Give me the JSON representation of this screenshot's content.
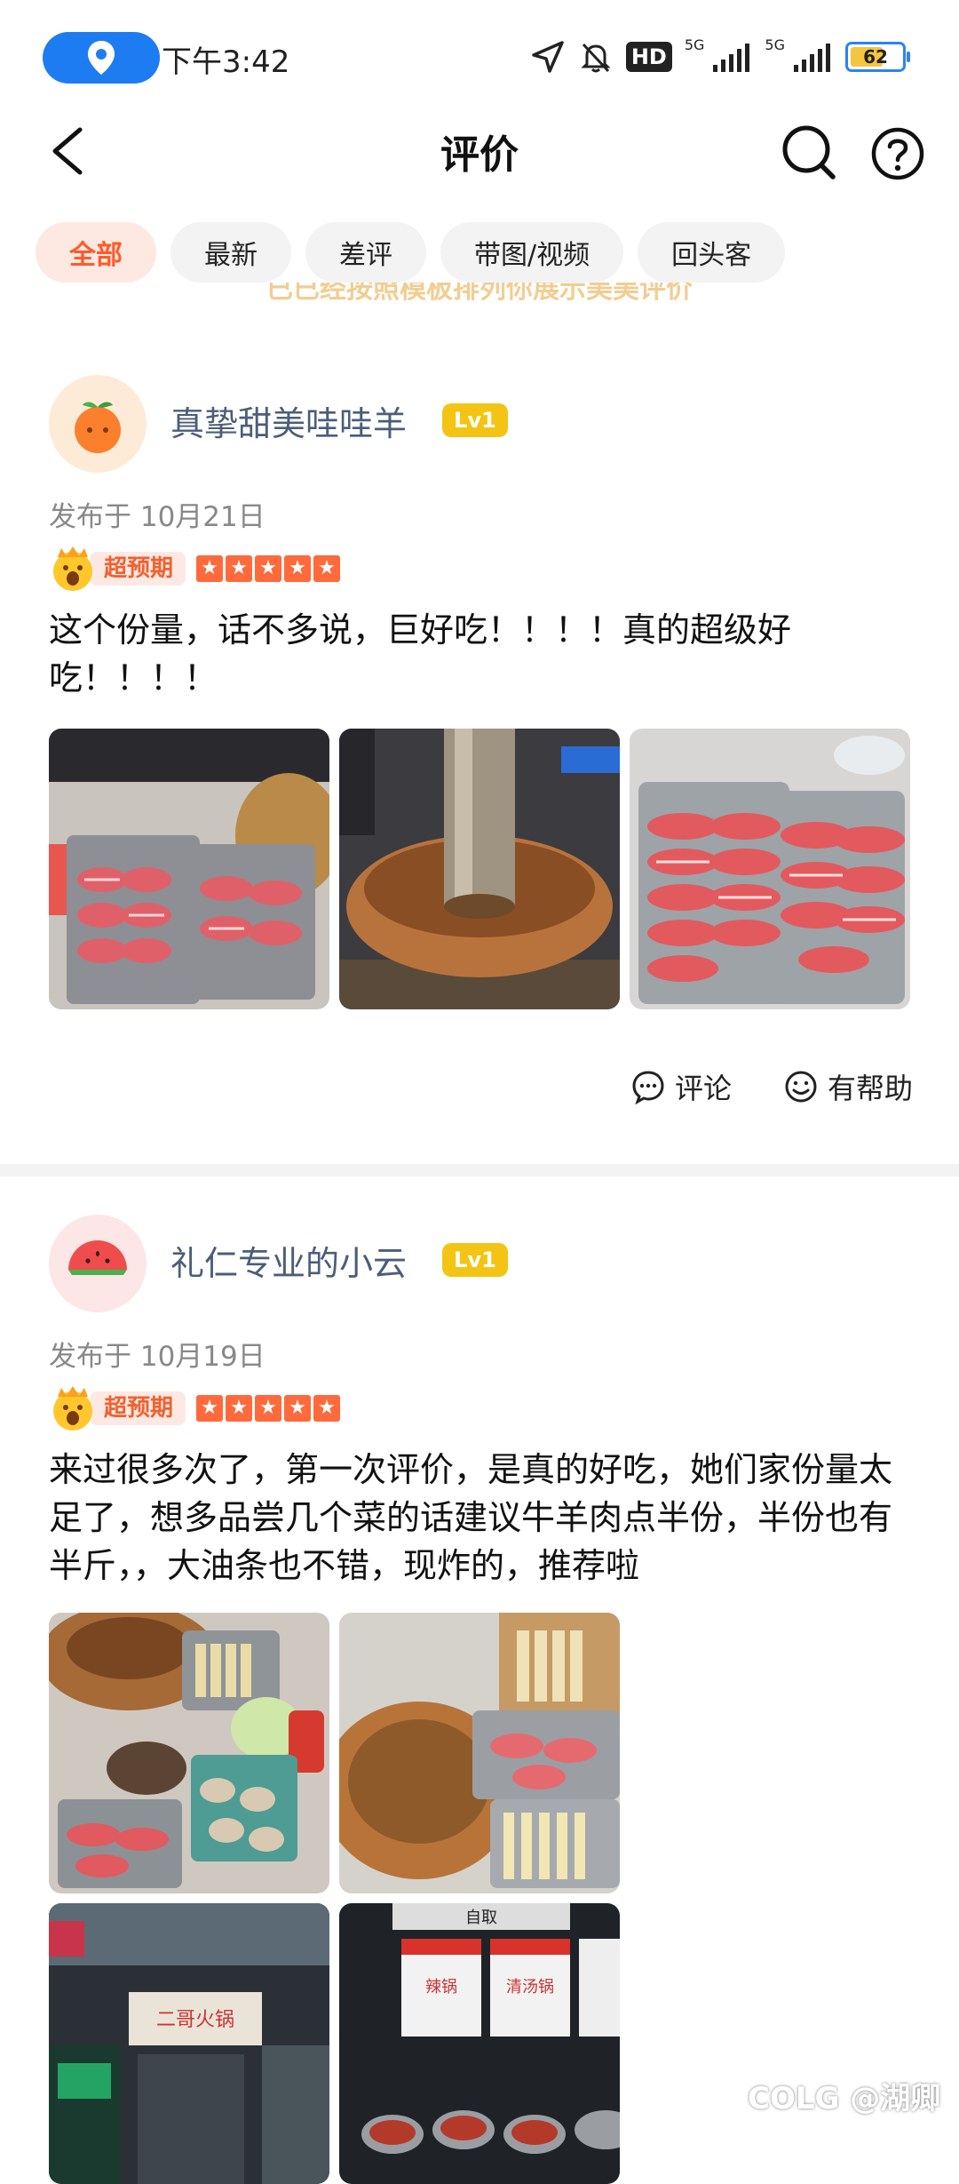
{
  "status_bar": {
    "time": "下午3:42",
    "hd": "HD",
    "net1": "5G",
    "net2": "5G",
    "battery": "62"
  },
  "nav": {
    "title": "评价"
  },
  "filters": [
    {
      "label": "全部",
      "active": true
    },
    {
      "label": "最新"
    },
    {
      "label": "差评"
    },
    {
      "label": "带图/视频"
    },
    {
      "label": "回头客"
    }
  ],
  "notice_partial": "已已经按照模板排列你展示美美评价",
  "reviews": [
    {
      "username": "真挚甜美哇哇羊",
      "level": "Lv1",
      "date": "发布于 10月21日",
      "badge": "超预期",
      "stars": 5,
      "text": "这个份量，话不多说，巨好吃！！！！真的超级好吃！！！！",
      "actions": {
        "comment": "评论",
        "helpful": "有帮助"
      }
    },
    {
      "username": "礼仁专业的小云",
      "level": "Lv1",
      "date": "发布于 10月19日",
      "badge": "超预期",
      "stars": 5,
      "text": "来过很多次了，第一次评价，是真的好吃，她们家份量太足了，想多品尝几个菜的话建议牛羊肉点半份，半份也有半斤，，大油条也不错，现炸的，推荐啦"
    }
  ],
  "photo_signs": {
    "self_serve": "自取",
    "spicy_pot": "辣锅",
    "clear_pot": "清汤锅",
    "restaurant_sign": "二哥火锅"
  },
  "watermark": "COLG @湖卿"
}
